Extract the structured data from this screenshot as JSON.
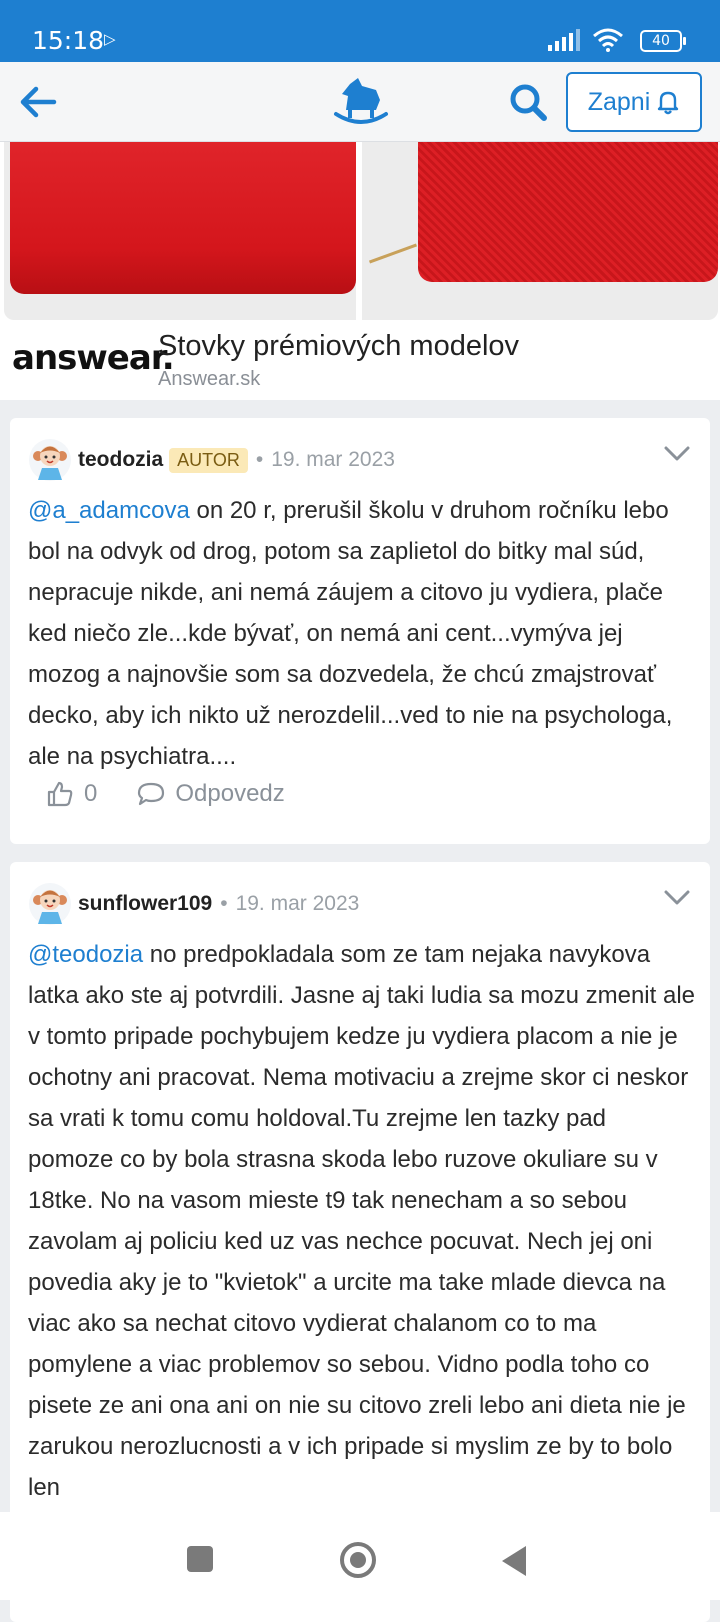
{
  "status_bar": {
    "time": "15:18",
    "battery": "40"
  },
  "header": {
    "subscribe_label": "Zapni"
  },
  "ad": {
    "brand": "answear.",
    "title": "Stovky prémiových modelov",
    "domain": "Answear.sk"
  },
  "posts": [
    {
      "username": "teodozia",
      "badge": "AUTOR",
      "date": "19. mar 2023",
      "mention": "@a_adamcova",
      "text": " on 20 r, prerušil školu v druhom ročníku lebo bol na odvyk od drog, potom sa zaplietol do bitky mal súd, nepracuje nikde, ani nemá záujem a citovo ju vydiera, plače ked niečo zle...kde bývať, on nemá ani cent...vymýva jej mozog a najnovšie som sa dozvedela, že chcú zmajstrovať decko, aby ich nikto už nerozdelil...ved to nie na psychologa, ale na psychiatra....",
      "likes": "0",
      "reply_label": "Odpovedz"
    },
    {
      "username": "sunflower109",
      "date": "19. mar 2023",
      "mention": "@teodozia",
      "text": " no predpokladala som ze tam nejaka navykova latka ako ste aj potvrdili. Jasne aj taki ludia sa mozu zmenit ale v tomto pripade pochybujem kedze ju vydiera placom a nie je ochotny ani pracovat. Nema motivaciu a zrejme skor ci neskor sa vrati k tomu comu holdoval.Tu zrejme len tazky pad pomoze co by bola strasna skoda lebo ruzove okuliare su v 18tke. No na vasom mieste t9 tak nenecham a so sebou zavolam aj policiu ked uz vas nechce pocuvat. Nech jej oni povedia aky je to \"kvietok\" a urcite ma take mlade dievca na viac ako sa nechat citovo vydierat chalanom co to ma pomylene a viac problemov so sebou. Vidno podla toho co pisete ze ani ona ani on nie su citovo zreli lebo ani dieta nie je zarukou nerozlucnosti a v ich pripade si myslim ze by to bolo len"
    }
  ],
  "colors": {
    "accent": "#1e7fd0",
    "badge_bg": "#fbe9b7"
  }
}
